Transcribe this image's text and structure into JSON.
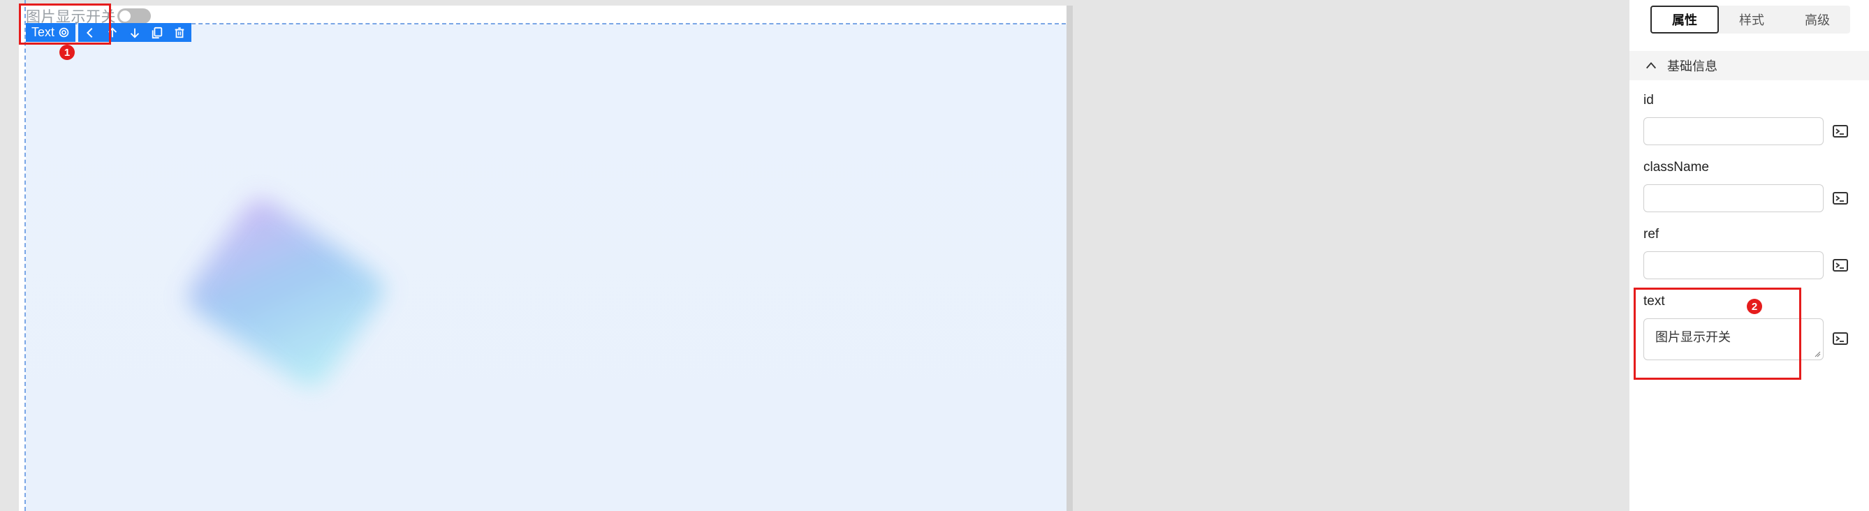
{
  "canvas": {
    "switch_label": "图片显示开关",
    "toolbar": {
      "component_name": "Text",
      "icons": [
        "settings-icon",
        "chevron-left-icon",
        "arrow-up-icon",
        "arrow-down-icon",
        "copy-icon",
        "trash-icon"
      ]
    },
    "annotations": [
      "1",
      "2"
    ]
  },
  "panel": {
    "tabs": [
      {
        "label": "属性",
        "active": true
      },
      {
        "label": "样式",
        "active": false
      },
      {
        "label": "高级",
        "active": false
      }
    ],
    "section_title": "基础信息",
    "fields": [
      {
        "label": "id",
        "value": ""
      },
      {
        "label": "className",
        "value": ""
      },
      {
        "label": "ref",
        "value": ""
      },
      {
        "label": "text",
        "value": "图片显示开关"
      }
    ]
  },
  "colors": {
    "accent": "#1a7cf5",
    "highlight": "#e51c1c",
    "canvas_bg": "#eaf2fd"
  }
}
